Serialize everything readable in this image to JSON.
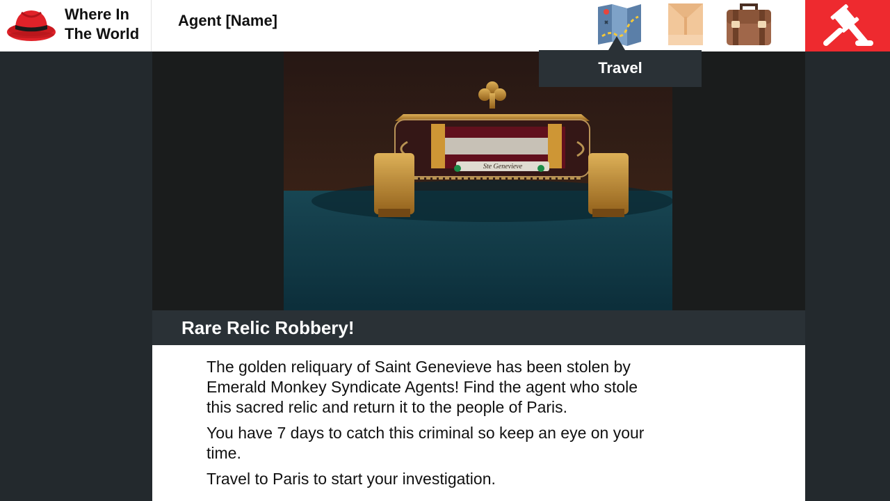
{
  "header": {
    "brand_line1": "Where In",
    "brand_line2": "The World",
    "agent_name": "Agent [Name]",
    "icons": [
      "red-fedora-icon",
      "map-icon",
      "envelope-icon",
      "briefcase-icon",
      "gavel-icon"
    ]
  },
  "tooltip": {
    "label": "Travel"
  },
  "case": {
    "title": "Rare Relic Robbery!",
    "paragraphs": [
      "The golden reliquary of Saint Genevieve has been stolen by Emerald Monkey Syndicate Agents! Find the agent who stole this sacred relic and return it to the people of Paris.",
      "You have 7 days to catch this criminal so keep an eye on your time.",
      "Travel to Paris to start your investigation."
    ],
    "image_inscription": "Ste Genevieve"
  },
  "colors": {
    "accent_red": "#ee2a2f",
    "dark_bg": "#23292d",
    "bar_bg": "#2a3136"
  }
}
